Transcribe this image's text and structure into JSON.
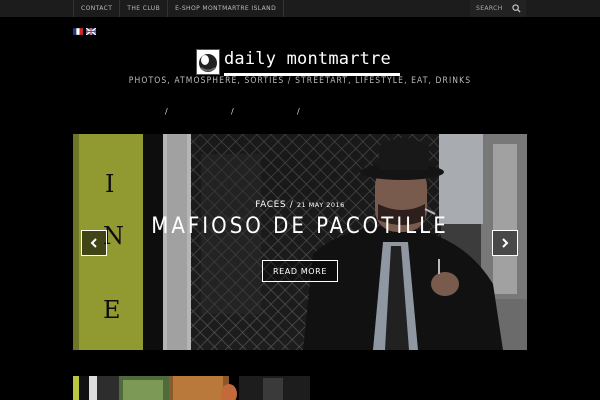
{
  "topnav": {
    "items": [
      "CONTACT",
      "THE CLUB",
      "E-SHOP MONTMARTRE ISLAND"
    ]
  },
  "search": {
    "placeholder": "SEARCH",
    "icon": "search-icon"
  },
  "flags": [
    {
      "name": "french-flag-icon"
    },
    {
      "name": "english-flag-icon"
    }
  ],
  "logo": {
    "text": "daily montmartre"
  },
  "tagline": "PHOTOS, ATMOSPHERE, SORTIES / STREETART, LIFESTYLE, EAT, DRINKS",
  "menu": {
    "separators": [
      "/",
      "/",
      "/"
    ]
  },
  "slider": {
    "category": "FACES",
    "separator": "/",
    "date": "21 MAY 2016",
    "title": "MAFIOSO DE PACOTILLE",
    "read_more": "READ MORE",
    "prev_icon": "chevron-left-icon",
    "next_icon": "chevron-right-icon"
  },
  "colors": {
    "background": "#000000",
    "topbar": "#1c1c1c",
    "accent": "#c8d64a",
    "text": "#ffffff"
  }
}
